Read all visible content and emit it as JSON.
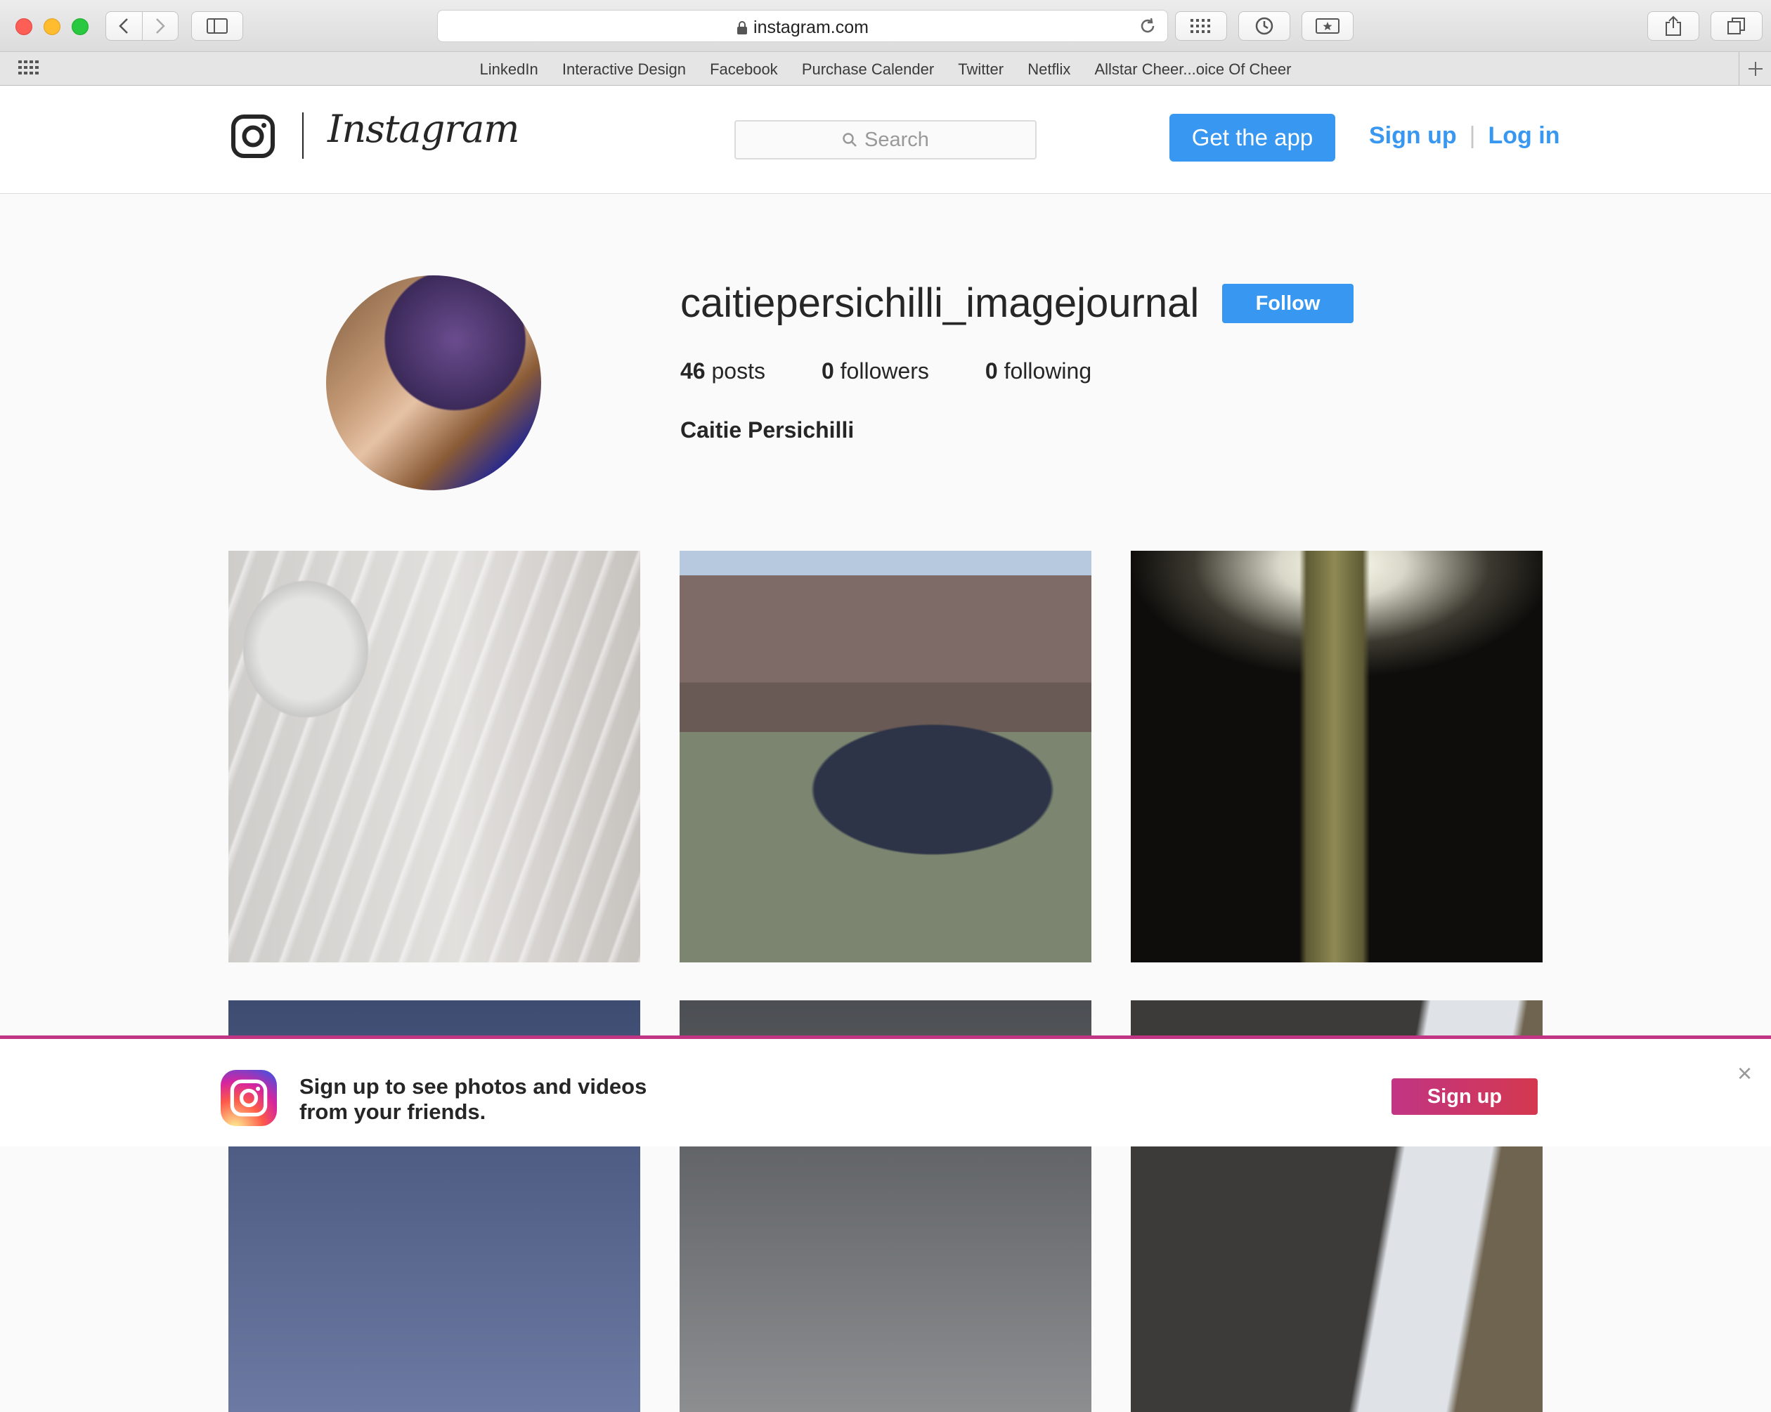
{
  "browser": {
    "url": "instagram.com",
    "bookmarks": [
      "LinkedIn",
      "Interactive Design",
      "Facebook",
      "Purchase Calender",
      "Twitter",
      "Netflix",
      "Allstar Cheer...oice Of Cheer"
    ]
  },
  "header": {
    "wordmark": "Instagram",
    "search_placeholder": "Search",
    "get_app_label": "Get the app",
    "signup_label": "Sign up",
    "separator": "|",
    "login_label": "Log in"
  },
  "profile": {
    "username": "caitiepersichilli_imagejournal",
    "follow_label": "Follow",
    "posts_count": "46",
    "posts_label": "posts",
    "followers_count": "0",
    "followers_label": "followers",
    "following_count": "0",
    "following_label": "following",
    "full_name": "Caitie Persichilli"
  },
  "signup_bar": {
    "line1": "Sign up to see photos and videos",
    "line2": "from your friends.",
    "button_label": "Sign up",
    "close_glyph": "×"
  },
  "colors": {
    "accent_blue": "#3897f0",
    "signup_gradient_start": "#c13584",
    "signup_gradient_end": "#d4384f"
  },
  "icons": [
    "back-icon",
    "forward-icon",
    "sidebar-icon",
    "lock-icon",
    "reload-icon",
    "top-sites-icon",
    "history-icon",
    "reading-list-icon",
    "share-icon",
    "tabs-icon",
    "search-icon",
    "instagram-glyph-icon",
    "close-icon"
  ]
}
